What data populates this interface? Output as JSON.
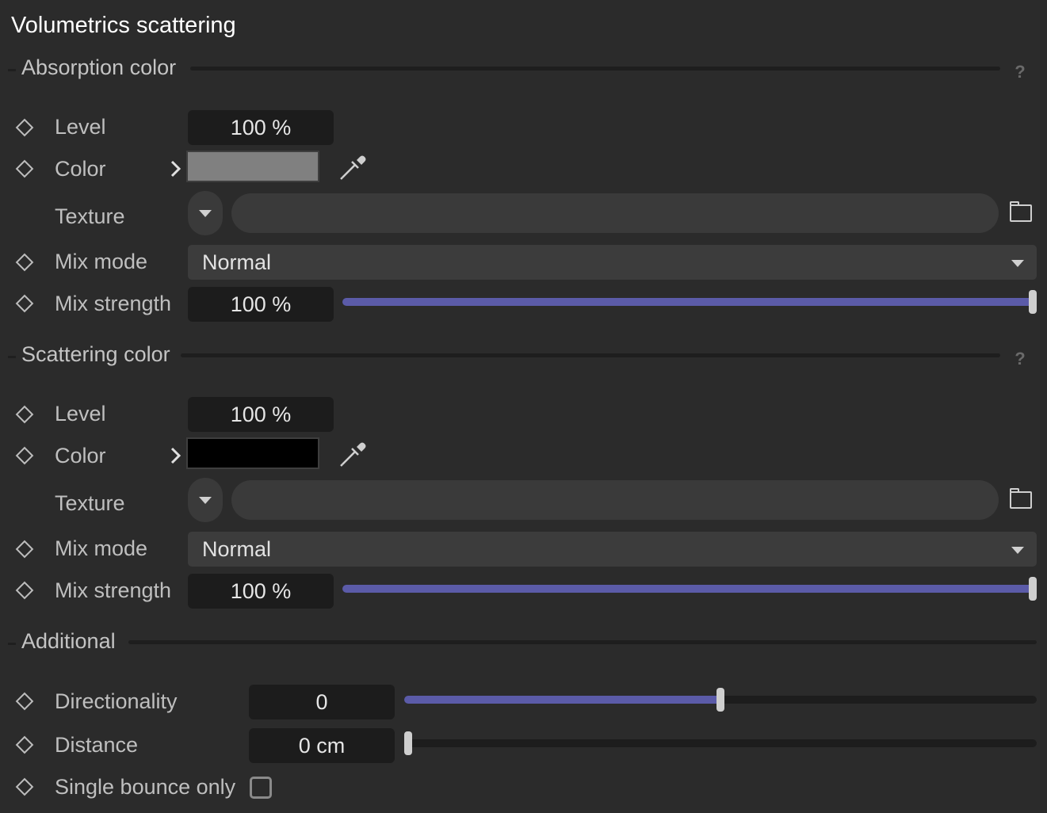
{
  "panel": {
    "title": "Volumetrics scattering"
  },
  "absorption": {
    "section_label": "Absorption color",
    "help": "?",
    "level": {
      "label": "Level",
      "value": "100 %"
    },
    "color": {
      "label": "Color",
      "swatch": "#808080"
    },
    "texture": {
      "label": "Texture",
      "value": ""
    },
    "mix_mode": {
      "label": "Mix mode",
      "value": "Normal"
    },
    "mix_strength": {
      "label": "Mix strength",
      "value": "100 %",
      "fraction": 1.0
    }
  },
  "scattering": {
    "section_label": "Scattering color",
    "help": "?",
    "level": {
      "label": "Level",
      "value": "100 %"
    },
    "color": {
      "label": "Color",
      "swatch": "#000000"
    },
    "texture": {
      "label": "Texture",
      "value": ""
    },
    "mix_mode": {
      "label": "Mix mode",
      "value": "Normal"
    },
    "mix_strength": {
      "label": "Mix strength",
      "value": "100 %",
      "fraction": 1.0
    }
  },
  "additional": {
    "section_label": "Additional",
    "directionality": {
      "label": "Directionality",
      "value": "0",
      "fraction": 0.5
    },
    "distance": {
      "label": "Distance",
      "value": "0 cm",
      "fraction": 0.0
    },
    "single_bounce": {
      "label": "Single bounce only",
      "checked": false
    }
  },
  "colors": {
    "accent": "#5b5ba8",
    "background": "#2b2b2b",
    "field": "#1c1c1c"
  },
  "icons": [
    "keyframe-diamond-icon",
    "chevron-right-icon",
    "eyedropper-icon",
    "dropdown-arrow-icon",
    "folder-icon",
    "help-icon",
    "checkbox-icon"
  ]
}
